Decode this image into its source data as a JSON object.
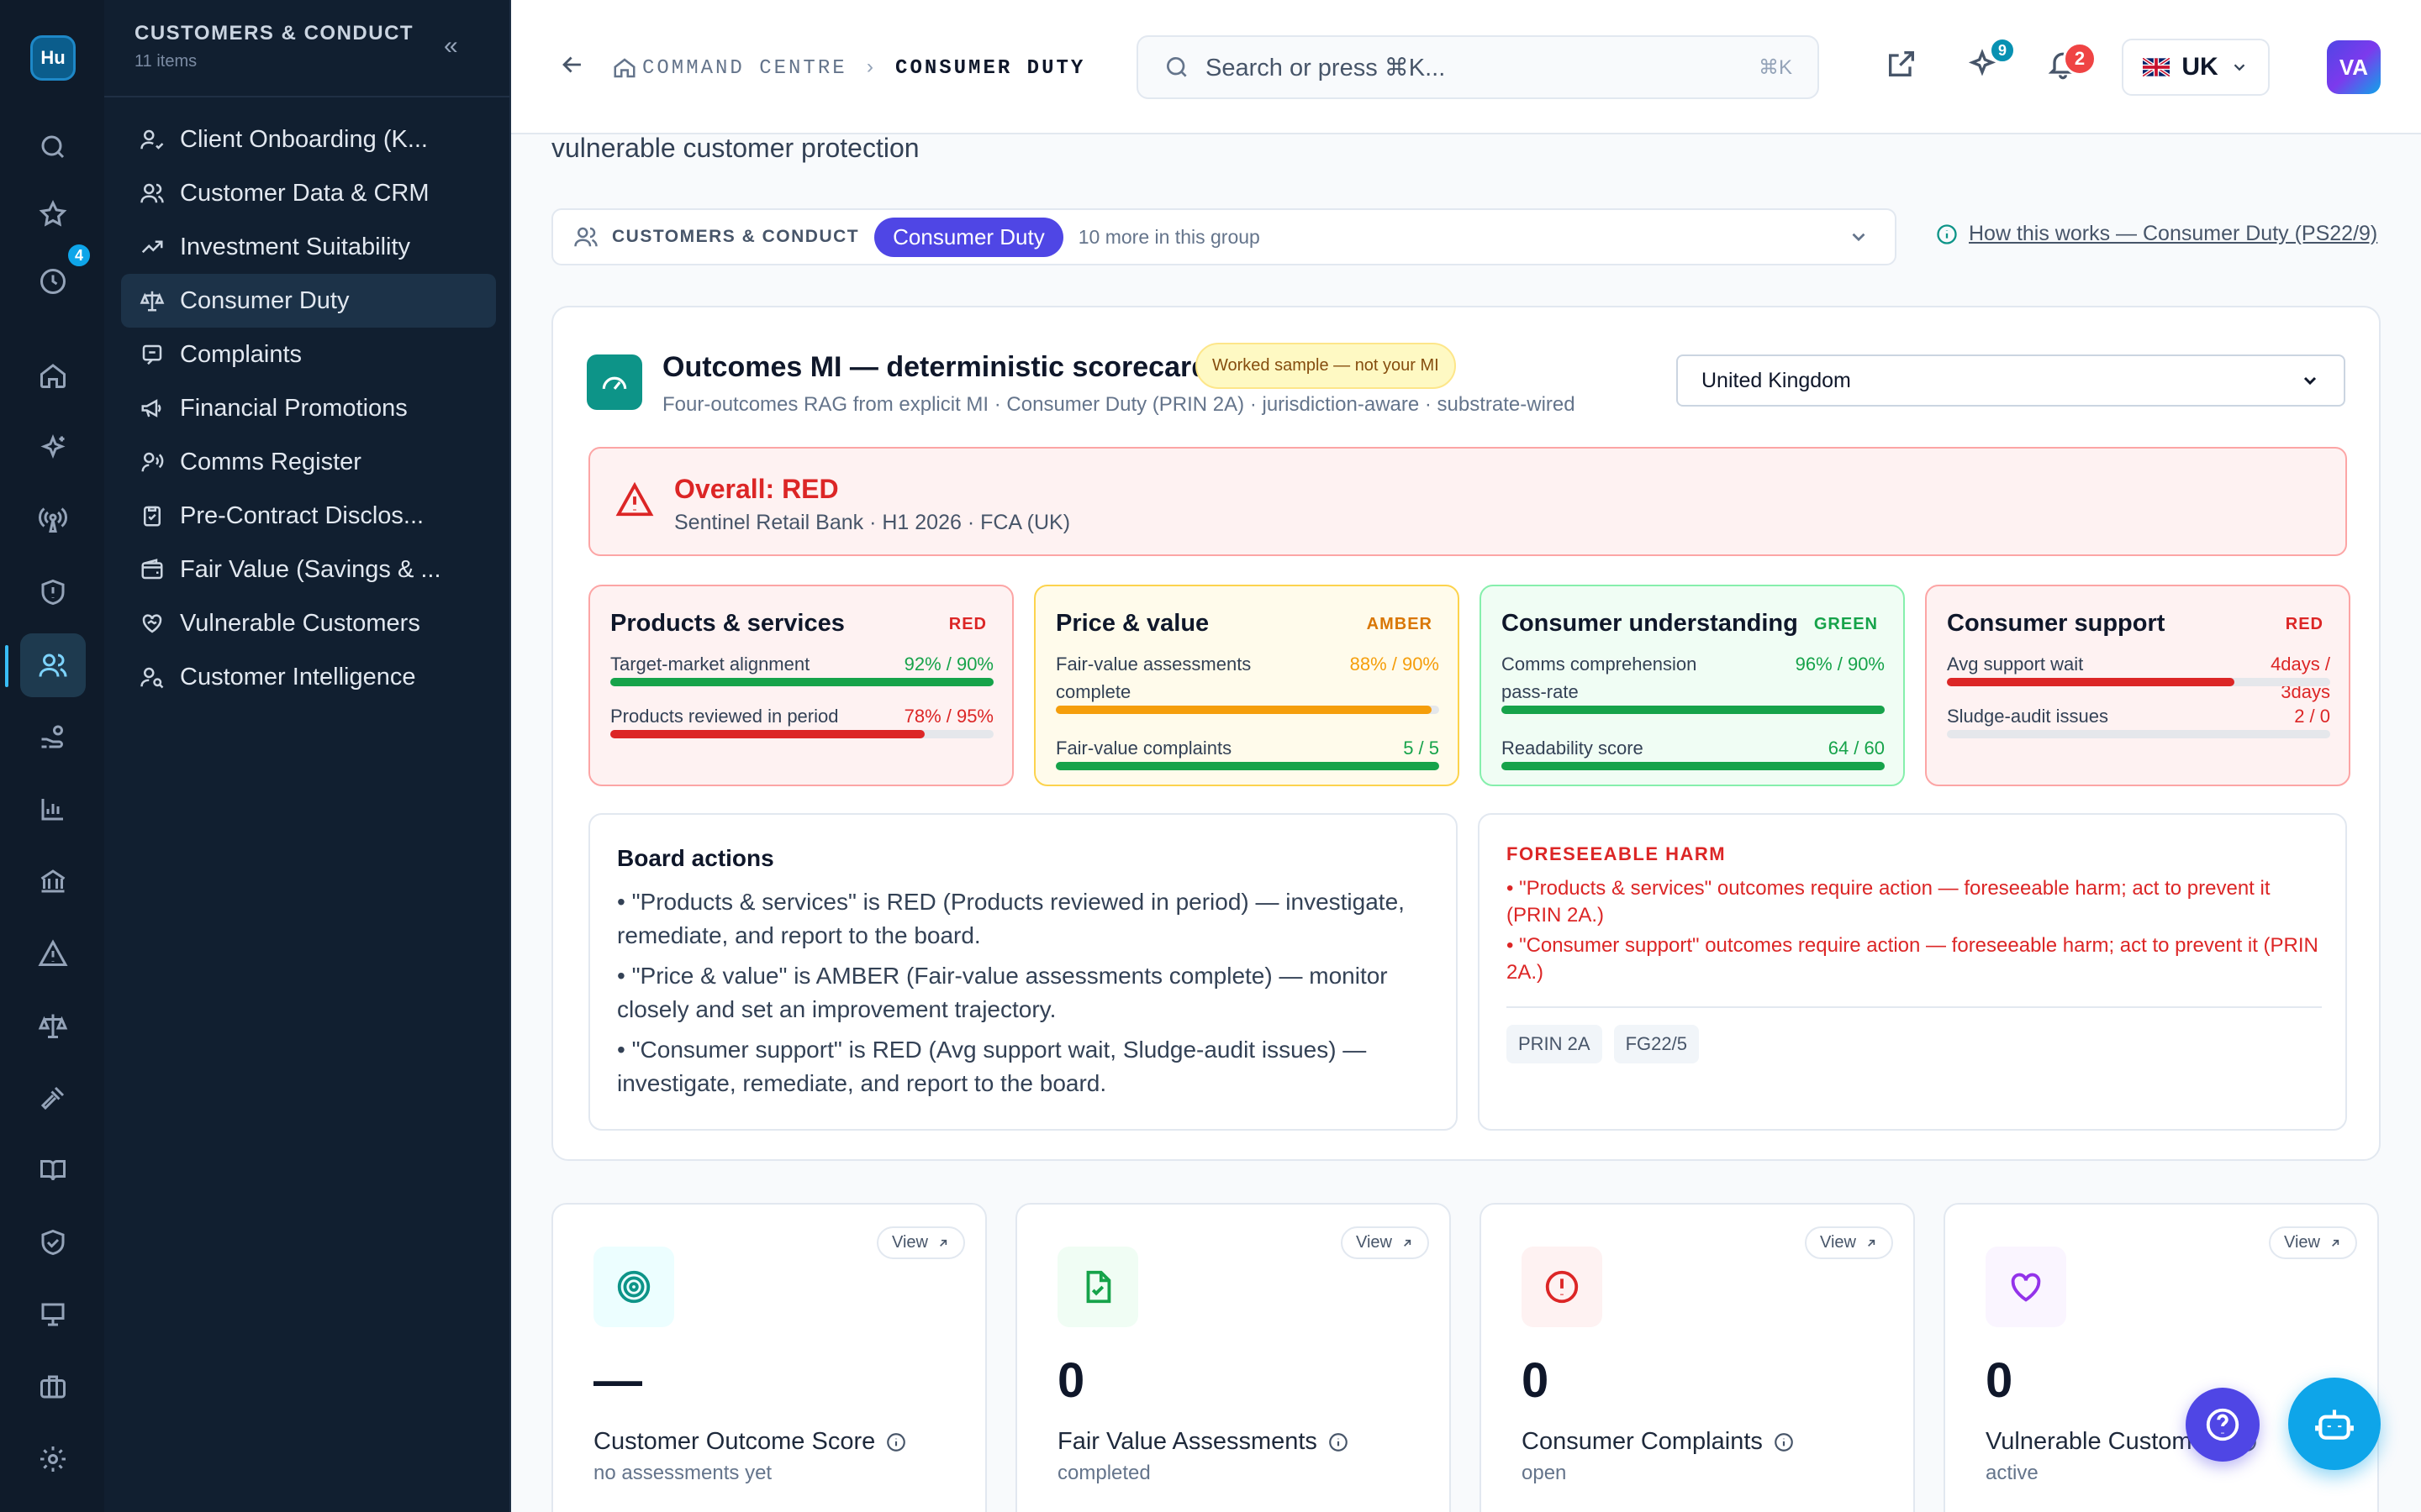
{
  "rail": {
    "logo": "Hu",
    "history_badge": "4"
  },
  "panel": {
    "group_title": "CUSTOMERS & CONDUCT",
    "group_count": "11 items",
    "items": [
      {
        "label": "Client Onboarding (K...",
        "icon": "user-check-icon"
      },
      {
        "label": "Customer Data & CRM",
        "icon": "users-icon"
      },
      {
        "label": "Investment Suitability",
        "icon": "trending-up-icon"
      },
      {
        "label": "Consumer Duty",
        "icon": "scale-icon"
      },
      {
        "label": "Complaints",
        "icon": "message-icon"
      },
      {
        "label": "Financial Promotions",
        "icon": "megaphone-icon"
      },
      {
        "label": "Comms Register",
        "icon": "voice-icon"
      },
      {
        "label": "Pre-Contract Disclos...",
        "icon": "clipboard-check-icon"
      },
      {
        "label": "Fair Value (Savings & ...",
        "icon": "wallet-icon"
      },
      {
        "label": "Vulnerable Customers",
        "icon": "heart-handshake-icon"
      },
      {
        "label": "Customer Intelligence",
        "icon": "user-search-icon"
      }
    ]
  },
  "topbar": {
    "breadcrumb_1": "COMMAND CENTRE",
    "breadcrumb_2": "CONSUMER DUTY",
    "search_placeholder": "Search or press ⌘K...",
    "search_shortcut": "⌘K",
    "ai_badge": "9",
    "notif_badge": "2",
    "region": "UK",
    "avatar": "VA"
  },
  "page": {
    "subtitle": "vulnerable customer protection",
    "group_label": "CUSTOMERS & CONDUCT",
    "group_pill": "Consumer Duty",
    "group_more": "10 more in this group",
    "how_link": "How this works — Consumer Duty (PS22/9)"
  },
  "card": {
    "title": "Outcomes MI — deterministic scorecard",
    "sample_badge": "Worked sample — not your MI",
    "subtitle": "Four-outcomes RAG from explicit MI · Consumer Duty (PRIN 2A) · jurisdiction-aware · substrate-wired",
    "jurisdiction": "United Kingdom",
    "overall_title": "Overall: RED",
    "overall_sub": "Sentinel Retail Bank · H1 2026 · FCA (UK)",
    "outcomes": [
      {
        "title": "Products & services",
        "status": "RED",
        "metrics": [
          {
            "label": "Target-market alignment",
            "value": "92% / 90%",
            "fill": 1.0,
            "color": "#16a34a"
          },
          {
            "label": "Products reviewed in period",
            "value": "78% / 95%",
            "fill": 0.82,
            "color": "#dc2626"
          }
        ]
      },
      {
        "title": "Price & value",
        "status": "AMBER",
        "metrics": [
          {
            "label": "Fair-value assessments complete",
            "value": "88% / 90%",
            "fill": 0.98,
            "color": "#f59e0b"
          },
          {
            "label": "Fair-value complaints",
            "value": "5 / 5",
            "fill": 1.0,
            "color": "#16a34a"
          }
        ]
      },
      {
        "title": "Consumer understanding",
        "status": "GREEN",
        "metrics": [
          {
            "label": "Comms comprehension pass-rate",
            "value": "96% / 90%",
            "fill": 1.0,
            "color": "#16a34a"
          },
          {
            "label": "Readability score",
            "value": "64 / 60",
            "fill": 1.0,
            "color": "#16a34a"
          }
        ]
      },
      {
        "title": "Consumer support",
        "status": "RED",
        "metrics": [
          {
            "label": "Avg support wait",
            "value": "4days / 3days",
            "fill": 0.75,
            "color": "#dc2626"
          },
          {
            "label": "Sludge-audit issues",
            "value": "2 / 0",
            "fill": 0.0,
            "color": "#dc2626"
          }
        ]
      }
    ],
    "board_title": "Board actions",
    "board_actions": [
      "• \"Products & services\" is RED (Products reviewed in period) — investigate, remediate, and report to the board.",
      "• \"Price & value\" is AMBER (Fair-value assessments complete) — monitor closely and set an improvement trajectory.",
      "• \"Consumer support\" is RED (Avg support wait, Sludge-audit issues) — investigate, remediate, and report to the board."
    ],
    "harm_title": "FORESEEABLE HARM",
    "harm_items": [
      "• \"Products & services\" outcomes require action — foreseeable harm; act to prevent it (PRIN 2A.)",
      "• \"Consumer support\" outcomes require action — foreseeable harm; act to prevent it (PRIN 2A.)"
    ],
    "tags": [
      "PRIN 2A",
      "FG22/5"
    ]
  },
  "kpis": [
    {
      "value": "—",
      "name": "Customer Outcome Score",
      "desc": "no assessments yet",
      "view": "View",
      "icon": "target-icon",
      "color": "#0d9488",
      "bg": "#ecfeff"
    },
    {
      "value": "0",
      "name": "Fair Value Assessments",
      "desc": "completed",
      "view": "View",
      "icon": "file-check-icon",
      "color": "#16a34a",
      "bg": "#f0fdf4"
    },
    {
      "value": "0",
      "name": "Consumer Complaints",
      "desc": "open",
      "view": "View",
      "icon": "alert-circle-icon",
      "color": "#dc2626",
      "bg": "#fef2f2"
    },
    {
      "value": "0",
      "name": "Vulnerable Customers",
      "desc": "active",
      "view": "View",
      "icon": "heart-icon",
      "color": "#9333ea",
      "bg": "#faf5ff"
    }
  ]
}
